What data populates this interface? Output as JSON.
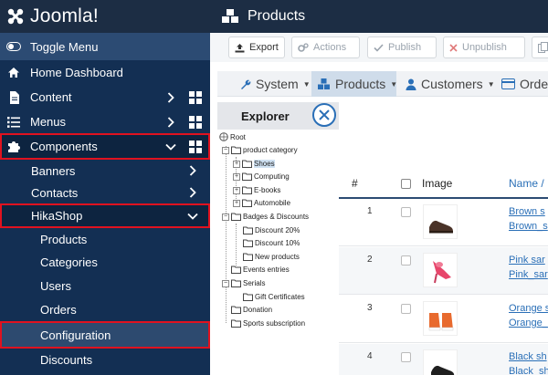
{
  "app": {
    "brand": "Joomla!"
  },
  "header": {
    "title": "Products"
  },
  "sidebar": {
    "toggle_label": "Toggle Menu",
    "items": [
      {
        "label": "Home Dashboard"
      },
      {
        "label": "Content"
      },
      {
        "label": "Menus"
      },
      {
        "label": "Components"
      }
    ],
    "components_sub": [
      {
        "label": "Banners"
      },
      {
        "label": "Contacts"
      },
      {
        "label": "HikaShop"
      }
    ],
    "hikashop_sub": [
      {
        "label": "Products"
      },
      {
        "label": "Categories"
      },
      {
        "label": "Users"
      },
      {
        "label": "Orders"
      },
      {
        "label": "Configuration"
      },
      {
        "label": "Discounts"
      }
    ]
  },
  "toolbar": {
    "export_label": "Export",
    "actions_label": "Actions",
    "publish_label": "Publish",
    "unpublish_label": "Unpublish"
  },
  "menubar": {
    "items": [
      {
        "label": "System"
      },
      {
        "label": "Products"
      },
      {
        "label": "Customers"
      },
      {
        "label": "Orders"
      }
    ]
  },
  "explorer": {
    "title": "Explorer",
    "nodes": [
      {
        "label": "Root"
      },
      {
        "label": "product category"
      },
      {
        "label": "Shoes"
      },
      {
        "label": "Computing"
      },
      {
        "label": "E-books"
      },
      {
        "label": "Automobile"
      },
      {
        "label": "Badges & Discounts"
      },
      {
        "label": "Discount 20%"
      },
      {
        "label": "Discount 10%"
      },
      {
        "label": "New products"
      },
      {
        "label": "Events entries"
      },
      {
        "label": "Serials"
      },
      {
        "label": "Gift Certificates"
      },
      {
        "label": "Donation"
      },
      {
        "label": "Sports subscription"
      }
    ]
  },
  "table": {
    "headers": {
      "num": "#",
      "image": "Image",
      "name": "Name /"
    },
    "rows": [
      {
        "num": "1",
        "name_line1": "Brown s",
        "name_line2": "Brown_s"
      },
      {
        "num": "2",
        "name_line1": "Pink sar",
        "name_line2": "Pink_sar"
      },
      {
        "num": "3",
        "name_line1": "Orange s",
        "name_line2": "Orange_"
      },
      {
        "num": "4",
        "name_line1": "Black sh",
        "name_line2": "Black_sh"
      }
    ]
  },
  "colors": {
    "sidebar_bg": "#132f53",
    "header_bg": "#1c2d44",
    "highlight_outline": "#e0121f",
    "link": "#2a6fb7"
  }
}
